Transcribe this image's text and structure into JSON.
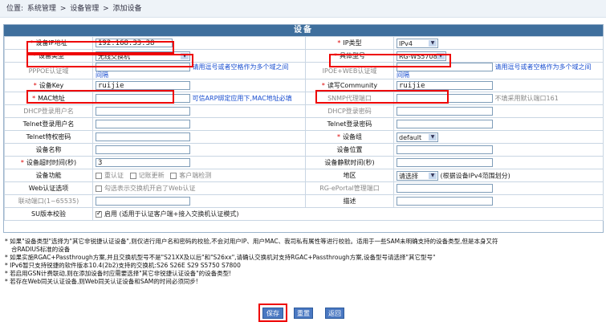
{
  "breadcrumb": {
    "prefix": "位置:",
    "items": [
      "系统管理",
      "设备管理",
      "添加设备"
    ],
    "sep": ">"
  },
  "panel_title": "设备",
  "rows": {
    "ip_label": "设备IP地址",
    "ip_value": "192.168.33.38",
    "iptype_label": "IP类型",
    "iptype_value": "IPv4",
    "devtype_label": "设备类型",
    "devtype_value": "无线交换机",
    "model_label": "具体型号",
    "model_value": "RG-WS5708",
    "pppoe_label": "PPPOE认证域",
    "hint_domain1": "请用逗号或者空格作为多个域之间",
    "hint_domain1b": "间隔",
    "ipoe_label": "IPOE+WEB认证域",
    "hint_domain2": "请用逗号或者空格作为多个域之间",
    "hint_domain2b": "间隔",
    "key_label": "设备Key",
    "key_value": "ruijie",
    "community_label": "读写Community",
    "community_value": "ruijie",
    "mac_label": "MAC地址",
    "mac_hint": "可信ARP绑定应用下,MAC地址必填",
    "snmp_label": "SNMP代理端口",
    "snmp_hint": "不填采用默认端口161",
    "dhcp_user_label": "DHCP登录用户名",
    "dhcp_pwd_label": "DHCP登录密码",
    "telnet_user_label": "Telnet登录用户名",
    "telnet_pwd_label": "Telnet登录密码",
    "telnet_priv_label": "Telnet特权密码",
    "group_label": "设备组",
    "group_value": "default",
    "name_label": "设备名称",
    "location_label": "设备位置",
    "timeout_label": "设备超时时间(秒)",
    "timeout_value": "3",
    "silent_label": "设备静默时间(秒)",
    "func_label": "设备功能",
    "func1": "重认证",
    "func2": "记账更新",
    "func3": "客户端检测",
    "region_label": "地区",
    "region_value": "请选择",
    "region_hint": "(根据设备IPv4范围划分)",
    "web_label": "Web认证选项",
    "web_text": "勾选表示交换机开启了Web认证",
    "eportal_label": "RG-ePortal管理端口",
    "link_label": "联动端口(1~65535)",
    "desc_label": "描述",
    "su_label": "SU版本校验",
    "su_text": "启用 (适用于认证客户端+接入交换机认证模式)"
  },
  "notes": [
    "* 如果\"设备类型\"选择为\"其它非锐捷认证设备\",则仅进行用户名和密码的校验,不会对用户IP、用户MAC、我司私有属性等进行校验。适用于一些SAM未明确支持的设备类型,但是本身又符",
    "合RADIUS标准的设备",
    "* 如果实施RGAC+Passthrough方案,并且交换机型号不是\"S21XX及以后\"和\"S26xx\",请确认交换机对支持RGAC+Passthrough方案,设备型号请选择\"其它型号\"",
    "* IPv6暂只支持锐捷的软件版本10.4(2b2)支持的交换机:S26 S26E S29 S5750 S7800",
    "* 若启用GSN计费联动,则在添加设备时应需要选择\"其它非锐捷认证设备\"的设备类型!",
    "* 若存在Web同关认证设备,则Web同关认证设备和SAM的时间必须同步!"
  ],
  "buttons": {
    "save": "保存",
    "reset": "重置",
    "back": "返回"
  }
}
